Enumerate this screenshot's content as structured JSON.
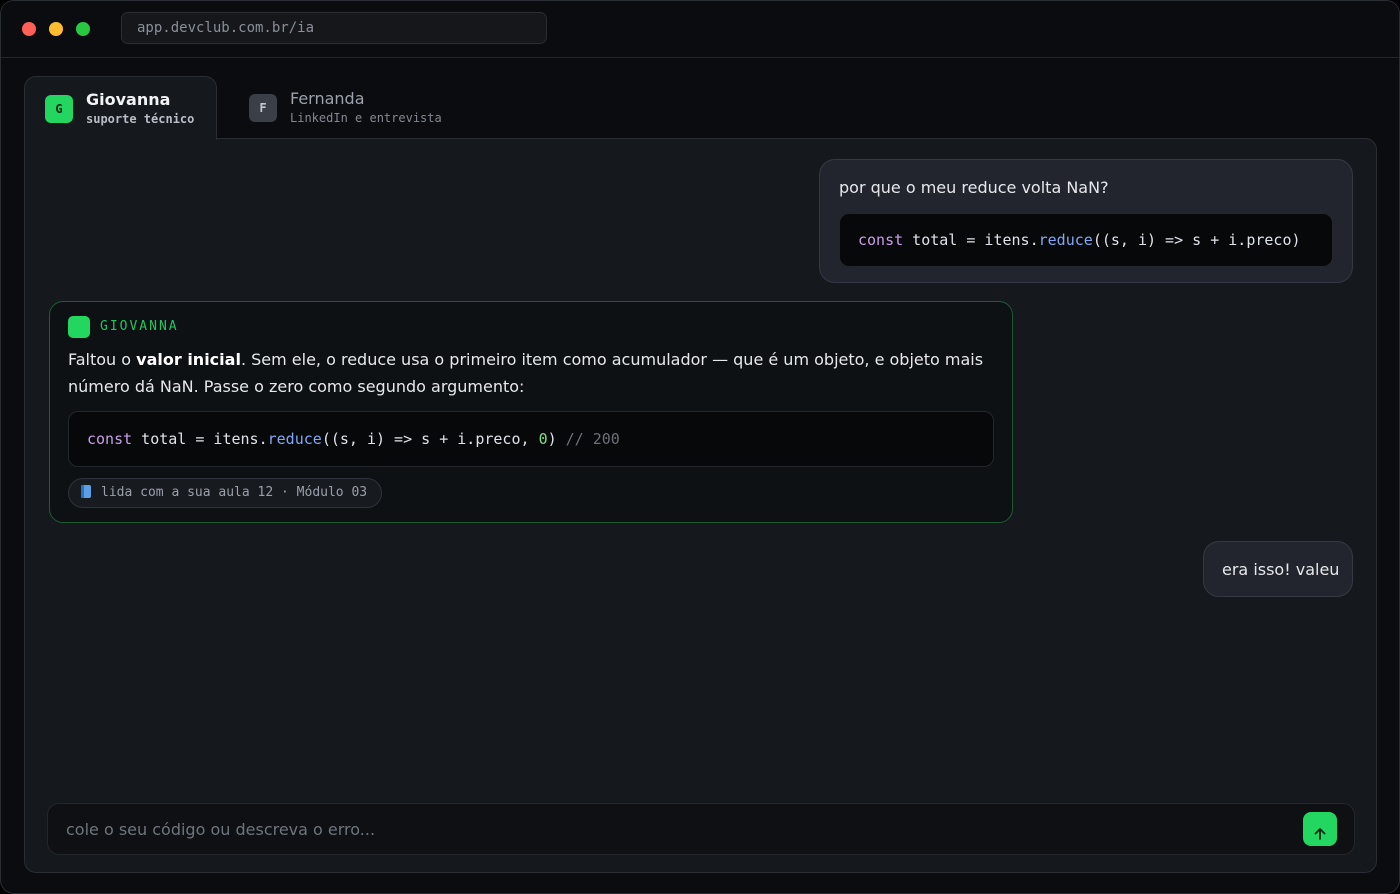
{
  "browser": {
    "url": "app.devclub.com.br/ia"
  },
  "tabs": [
    {
      "initial": "G",
      "name": "Giovanna",
      "subtitle": "suporte técnico",
      "active": true
    },
    {
      "initial": "F",
      "name": "Fernanda",
      "subtitle": "LinkedIn e entrevista",
      "active": false
    }
  ],
  "conversation": {
    "user_message_1": {
      "text": "por que o meu reduce volta NaN?",
      "code": {
        "kw": "const",
        "a": " total = itens.",
        "fn": "reduce",
        "b": "((s, i) => s + i.preco)"
      }
    },
    "assistant_message": {
      "label": "GIOVANNA",
      "text_before": "Faltou o ",
      "text_bold": "valor inicial",
      "text_after": ". Sem ele, o reduce usa o primeiro item como acumulador — que é um objeto, e objeto mais número dá NaN. Passe o zero como segundo argumento:",
      "code": {
        "kw": "const",
        "a": " total = itens.",
        "fn": "reduce",
        "b": "((s, i) => s + i.preco, ",
        "num": "0",
        "c": ") ",
        "comment": "// 200"
      },
      "source": "lida com a sua aula 12 · Módulo 03"
    },
    "user_message_2": {
      "text": "era isso! valeu"
    }
  },
  "composer": {
    "placeholder": "cole o seu código ou descreva o erro...",
    "value": ""
  },
  "colors": {
    "accent": "#22d65f",
    "keyword": "#c99ee8",
    "function": "#7fa9f5",
    "number": "#7ee08a",
    "comment": "#6b7079"
  }
}
